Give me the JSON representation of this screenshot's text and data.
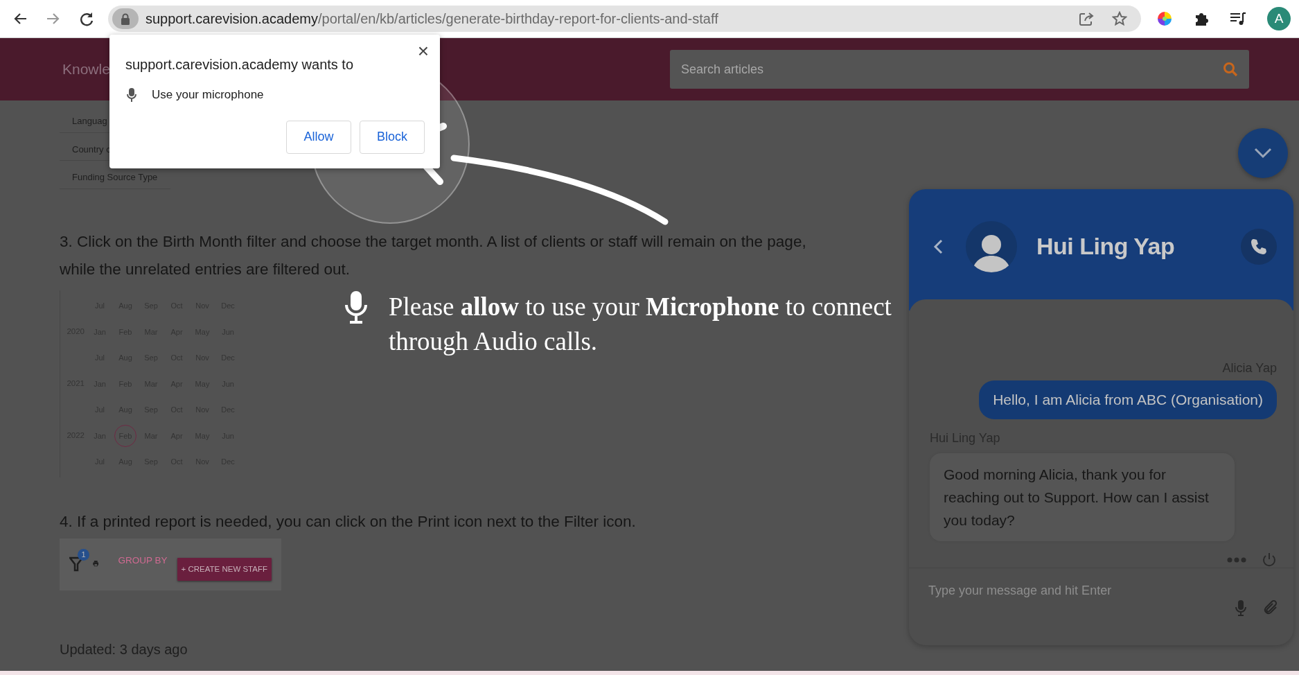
{
  "browser": {
    "url_host": "support.carevision.academy",
    "url_path": "/portal/en/kb/articles/generate-birthday-report-for-clients-and-staff",
    "profile_initial": "A"
  },
  "permission_popup": {
    "title": "support.carevision.academy wants to",
    "request": "Use your microphone",
    "close": "×",
    "buttons": [
      "Allow",
      "Block"
    ]
  },
  "header": {
    "title": "Knowle",
    "search": {
      "placeholder": "Search articles"
    }
  },
  "article": {
    "form_fields": [
      "Languag",
      "Country c",
      "Funding Source Type"
    ],
    "step_3": "3. Click on the Birth Month filter and choose the target month. A list of clients or staff will remain on the page, while the unrelated entries are filtered out.",
    "month_grid": [
      {
        "months": [
          {
            "label": "Jul",
            "selected": false
          },
          {
            "label": "Aug",
            "selected": false
          },
          {
            "label": "Sep",
            "selected": false
          },
          {
            "label": "Oct",
            "selected": false
          },
          {
            "label": "Nov",
            "selected": false
          },
          {
            "label": "Dec",
            "selected": false
          }
        ]
      },
      {
        "year": "2020",
        "months": [
          {
            "label": "Jan",
            "selected": false
          },
          {
            "label": "Feb",
            "selected": false
          },
          {
            "label": "Mar",
            "selected": false
          },
          {
            "label": "Apr",
            "selected": false
          },
          {
            "label": "May",
            "selected": false
          },
          {
            "label": "Jun",
            "selected": false
          }
        ]
      },
      {
        "months": [
          {
            "label": "Jul",
            "selected": false
          },
          {
            "label": "Aug",
            "selected": false
          },
          {
            "label": "Sep",
            "selected": false
          },
          {
            "label": "Oct",
            "selected": false
          },
          {
            "label": "Nov",
            "selected": false
          },
          {
            "label": "Dec",
            "selected": false
          }
        ]
      },
      {
        "year": "2021",
        "months": [
          {
            "label": "Jan",
            "selected": false
          },
          {
            "label": "Feb",
            "selected": false
          },
          {
            "label": "Mar",
            "selected": false
          },
          {
            "label": "Apr",
            "selected": false
          },
          {
            "label": "May",
            "selected": false
          },
          {
            "label": "Jun",
            "selected": false
          }
        ]
      },
      {
        "months": [
          {
            "label": "Jul",
            "selected": false
          },
          {
            "label": "Aug",
            "selected": false
          },
          {
            "label": "Sep",
            "selected": false
          },
          {
            "label": "Oct",
            "selected": false
          },
          {
            "label": "Nov",
            "selected": false
          },
          {
            "label": "Dec",
            "selected": false
          }
        ]
      },
      {
        "year": "2022",
        "months": [
          {
            "label": "Jan",
            "selected": false
          },
          {
            "label": "Feb",
            "selected": true
          },
          {
            "label": "Mar",
            "selected": false
          },
          {
            "label": "Apr",
            "selected": false
          },
          {
            "label": "May",
            "selected": false
          },
          {
            "label": "Jun",
            "selected": false
          }
        ]
      },
      {
        "months": [
          {
            "label": "Jul",
            "selected": false
          },
          {
            "label": "Aug",
            "selected": false
          },
          {
            "label": "Sep",
            "selected": false
          },
          {
            "label": "Oct",
            "selected": false
          },
          {
            "label": "Nov",
            "selected": false
          },
          {
            "label": "Dec",
            "selected": false
          }
        ]
      }
    ],
    "step_4": "4. If a printed report is needed, you can click on the Print icon next to the Filter icon.",
    "toolbar_image": {
      "filter_count": "1",
      "group_by": "GROUP BY",
      "create_button": "+ CREATE NEW STAFF"
    },
    "updated": "Updated: 3 days ago"
  },
  "tutorial_overlay": {
    "message": "Please **allow** to use your **Microphone** to connect through Audio calls."
  },
  "chat": {
    "contact_name": "Hui Ling Yap",
    "messages": [
      {
        "kind": "outgoing",
        "sender": "Alicia Yap",
        "text": "Hello, I am Alicia from ABC (Organisation)"
      },
      {
        "kind": "incoming",
        "sender": "Hui Ling Yap",
        "text": "Good morning Alicia, thank you for reaching out to Support. How can I assist you today?"
      }
    ],
    "input": {
      "placeholder": "Type your message and hit Enter"
    }
  }
}
